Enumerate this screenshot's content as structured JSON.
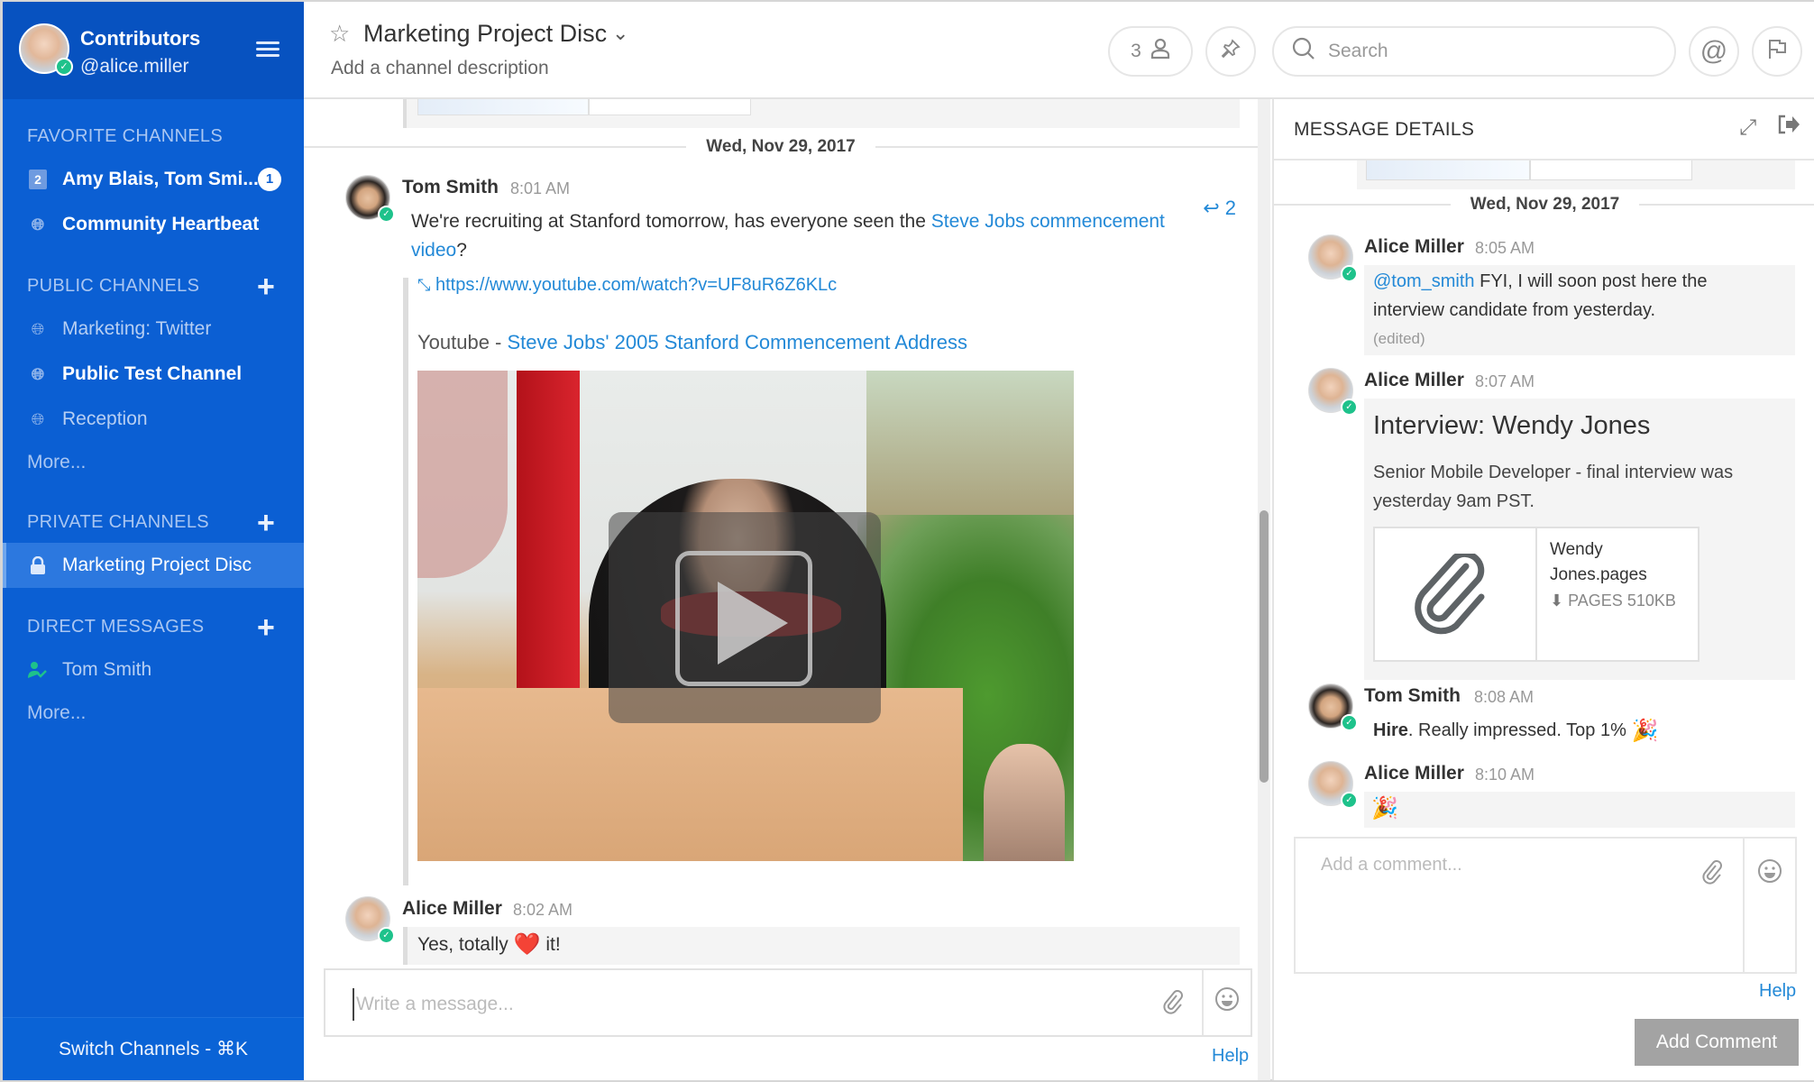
{
  "sidebar": {
    "team_name": "Contributors",
    "username": "@alice.miller",
    "sections": {
      "favorites": {
        "title": "FAVORITE CHANNELS"
      },
      "public": {
        "title": "PUBLIC CHANNELS"
      },
      "private": {
        "title": "PRIVATE CHANNELS"
      },
      "direct": {
        "title": "DIRECT MESSAGES"
      }
    },
    "favorites": [
      {
        "label": "Amy Blais, Tom Smi...",
        "member_count": "2",
        "unread": "1",
        "icon": "group-number-icon"
      },
      {
        "label": "Community Heartbeat",
        "icon": "globe-icon"
      }
    ],
    "public_channels": [
      {
        "label": "Marketing: Twitter",
        "icon": "globe-icon"
      },
      {
        "label": "Public Test Channel",
        "icon": "globe-icon"
      },
      {
        "label": "Reception",
        "icon": "globe-icon"
      }
    ],
    "public_more": "More...",
    "private_channels": [
      {
        "label": "Marketing Project Disc",
        "icon": "lock-icon",
        "active": true
      }
    ],
    "direct_messages": [
      {
        "label": "Tom Smith",
        "icon": "online-user-icon"
      }
    ],
    "direct_more": "More...",
    "switch_channels": "Switch Channels - ⌘K"
  },
  "channel_header": {
    "title": "Marketing Project Disc",
    "description": "Add a channel description",
    "member_count": "3",
    "search_placeholder": "Search"
  },
  "center": {
    "date_separator": "Wed, Nov 29, 2017",
    "messages": [
      {
        "author": "Tom Smith",
        "time": "8:01 AM",
        "text_before": "We're recruiting at Stanford tomorrow, has everyone seen the ",
        "link_text": "Steve Jobs commencement video",
        "text_after": "?",
        "reply_count": "2",
        "embed_url": "https://www.youtube.com/watch?v=UF8uR6Z6KLc",
        "embed_site": "Youtube - ",
        "embed_title": "Steve Jobs' 2005 Stanford Commencement Address"
      },
      {
        "author": "Alice Miller",
        "time": "8:02 AM",
        "text_before": "Yes, totally ",
        "emoji": "❤️",
        "text_after": " it!"
      }
    ],
    "composer_placeholder": "Write a message...",
    "help": "Help"
  },
  "right_panel": {
    "title": "MESSAGE DETAILS",
    "date_separator": "Wed, Nov 29, 2017",
    "messages": [
      {
        "author": "Alice Miller",
        "time": "8:05 AM",
        "mention": "@tom_smith",
        "text": " FYI, I will soon post here the interview candidate from yesterday.",
        "edited": "(edited)"
      },
      {
        "author": "Alice Miller",
        "time": "8:07 AM",
        "heading": "Interview: Wendy Jones",
        "text": "Senior Mobile Developer - final interview was yesterday 9am PST.",
        "attachment": {
          "name": "Wendy Jones.pages",
          "type": "PAGES",
          "size": "510KB"
        }
      },
      {
        "author": "Tom Smith",
        "time": "8:08 AM",
        "bold": "Hire",
        "text": ". Really impressed. Top 1% ",
        "emoji": "🎉"
      },
      {
        "author": "Alice Miller",
        "time": "8:10 AM",
        "emoji": "🎉"
      }
    ],
    "comment_placeholder": "Add a comment...",
    "help": "Help",
    "add_comment": "Add Comment"
  },
  "colors": {
    "sidebar": "#0b5fd3",
    "sidebar_header": "#0752c0",
    "link": "#2389d7",
    "online": "#1ec28b",
    "button_disabled": "#a3a3a3"
  }
}
